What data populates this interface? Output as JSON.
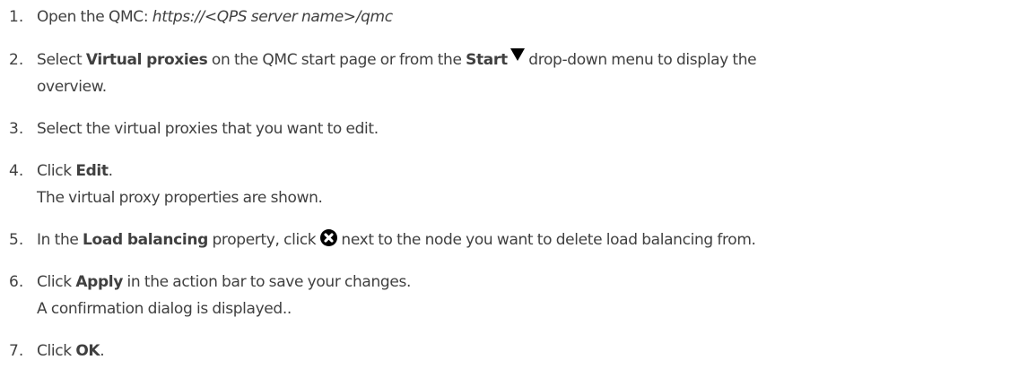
{
  "steps": [
    {
      "number": "1.",
      "lines": [
        {
          "text_a": "Open the QMC: ",
          "url": "https://<QPS server name>/qmc"
        }
      ]
    },
    {
      "number": "2.",
      "text_a": "Select ",
      "bold_a": "Virtual proxies",
      "text_b": " on the QMC start page or from the ",
      "bold_b": "Start",
      "text_c": " drop-down menu to display the",
      "text_d": "overview."
    },
    {
      "number": "3.",
      "text_a": "Select the virtual proxies that you want to edit."
    },
    {
      "number": "4.",
      "text_a": "Click ",
      "bold_a": "Edit",
      "text_b": ".",
      "text_c": "The virtual proxy properties are shown."
    },
    {
      "number": "5.",
      "text_a": "In the ",
      "bold_a": "Load balancing",
      "text_b": " property, click ",
      "text_c": " next to the node you want to delete load balancing from."
    },
    {
      "number": "6.",
      "text_a": "Click ",
      "bold_a": "Apply",
      "text_b": " in the action bar to save your changes.",
      "text_c": "A confirmation dialog is displayed.."
    },
    {
      "number": "7.",
      "text_a": "Click ",
      "bold_a": "OK",
      "text_b": "."
    }
  ],
  "icons": {
    "start_menu": "triangle-down-icon",
    "delete": "circle-x-icon"
  },
  "colors": {
    "text": "#404040",
    "icon": "#000000"
  }
}
